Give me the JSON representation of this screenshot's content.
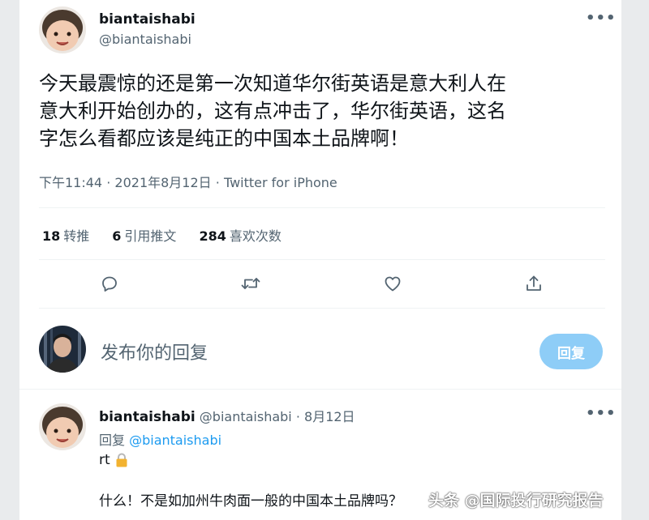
{
  "tweet": {
    "display_name": "biantaishabi",
    "handle": "@biantaishabi",
    "text_line1": "今天最震惊的还是第一次知道华尔街英语是意大利人在",
    "text_line2": "意大利开始创办的，这有点冲击了，华尔街英语，这名",
    "text_line3": "字怎么看都应该是纯正的中国本土品牌啊！",
    "time": "下午11:44",
    "date": "2021年8月12日",
    "source": "Twitter for iPhone",
    "separator": "·",
    "more_icon": "more-icon"
  },
  "stats": {
    "retweets_count": "18",
    "retweets_label": "转推",
    "quotes_count": "6",
    "quotes_label": "引用推文",
    "likes_count": "284",
    "likes_label": "喜欢次数"
  },
  "compose": {
    "placeholder": "发布你的回复",
    "button_label": "回复"
  },
  "reply": {
    "display_name": "biantaishabi",
    "handle": "@biantaishabi",
    "separator": "·",
    "date": "8月12日",
    "replying_prefix": "回复",
    "replying_to": "@biantaishabi",
    "text_line1": "rt",
    "text_line2": "什么！不是如加州牛肉面一般的中国本土品牌吗？"
  },
  "watermark": {
    "text": "头条 @国际投行研究报告"
  },
  "colors": {
    "accent": "#1d9bf0",
    "reply_button": "#8ecdf7",
    "secondary_text": "#536471"
  }
}
